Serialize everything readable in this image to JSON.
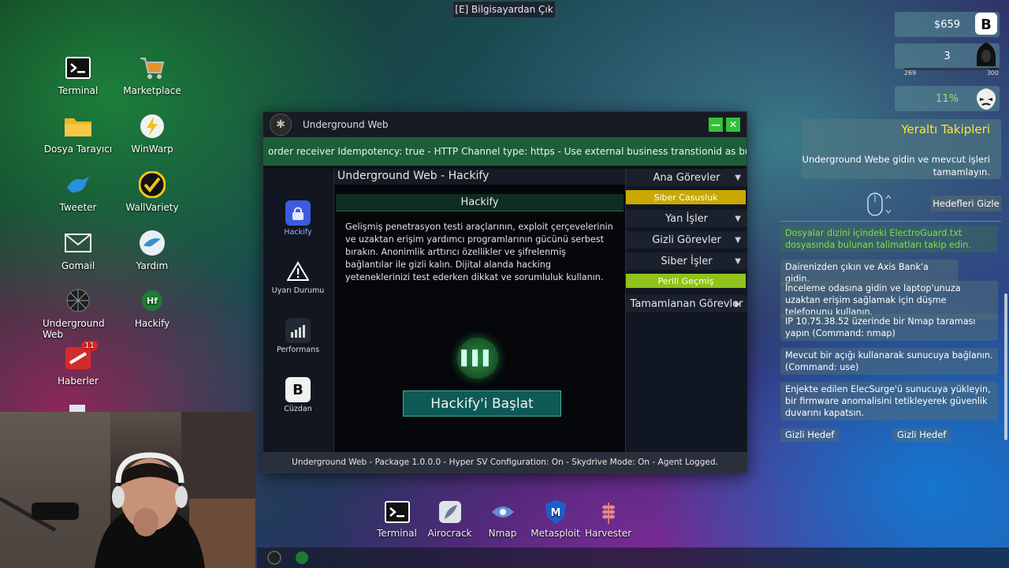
{
  "top_button": "[E] Bilgisayardan Çık",
  "desktop": {
    "icons": [
      {
        "label": "Terminal",
        "icon": "terminal-icon"
      },
      {
        "label": "Marketplace",
        "icon": "cart-icon"
      },
      {
        "label": "Dosya Tarayıcı",
        "icon": "folder-icon"
      },
      {
        "label": "WinWarp",
        "icon": "lightning-icon"
      },
      {
        "label": "Tweeter",
        "icon": "bird-icon"
      },
      {
        "label": "WallVariety",
        "icon": "wallpaper-icon"
      },
      {
        "label": "Gomail",
        "icon": "mail-icon"
      },
      {
        "label": "Yardım",
        "icon": "help-bird-icon"
      },
      {
        "label": "Underground Web",
        "icon": "web-icon"
      },
      {
        "label": "Hackify",
        "icon": "hackify-icon"
      },
      {
        "label": "Haberler",
        "icon": "news-icon",
        "badge": "11"
      }
    ]
  },
  "window": {
    "title": "Underground Web",
    "marquee": "order receiver Idempotency: true - HTTP Channel type: https - Use external business transtionid as business transa",
    "nav": [
      {
        "label": "Hackify",
        "icon": "lock-icon"
      },
      {
        "label": "Uyarı Durumu",
        "icon": "warning-icon"
      },
      {
        "label": "Performans",
        "icon": "chart-icon"
      },
      {
        "label": "Cüzdan",
        "icon": "wallet-icon"
      }
    ],
    "header": "Underground Web - Hackify",
    "section_title": "Hackify",
    "description": "Gelişmiş penetrasyon testi araçlarının, exploit çerçevelerinin ve uzaktan erişim yardımcı programlarının gücünü serbest bırakın. Anonimlik arttırıcı özellikler ve şifrelenmiş bağlantılar ile gizli kalın. Dijital alanda hacking yeteneklerinizi test ederken dikkat ve sorumluluk kullanın.",
    "start_button": "Hackify'i Başlat",
    "menu": {
      "ana": "Ana Görevler",
      "siber_casusluk": "Siber Casusluk",
      "yan": "Yan İşler",
      "gizli": "Gizli Görevler",
      "siber": "Siber İşler",
      "perili": "Perili Geçmiş",
      "tamamlanan": "Tamamlanan Görevler"
    },
    "status": "Underground Web - Package 1.0.0.0 - Hyper SV Configuration: On - Skydrive Mode: On - Agent Logged."
  },
  "taskbar": [
    {
      "label": "Terminal",
      "icon": "terminal-icon"
    },
    {
      "label": "Airocrack",
      "icon": "feather-icon"
    },
    {
      "label": "Nmap",
      "icon": "eye-icon"
    },
    {
      "label": "Metasploit",
      "icon": "shield-m-icon"
    },
    {
      "label": "Harvester",
      "icon": "wheat-icon"
    }
  ],
  "hud": {
    "money": "$659",
    "level": "3",
    "xp_min": "269",
    "xp_max": "300",
    "xp_progress": 0.9,
    "percent": "11%"
  },
  "quest": {
    "title": "Yeraltı Takipleri",
    "desc": "Underground Webe gidin ve mevcut işleri tamamlayın.",
    "hide_button": "Hedefleri Gizle",
    "tasks": [
      "Dosyalar dizini içindeki ElectroGuard.txt dosyasında bulunan talimatları takip edin.",
      "Dairenizden çıkın ve Axis Bank'a gidin.",
      "İnceleme odasına gidin ve laptop'unuza uzaktan erişim sağlamak için düşme telefonunu kullanın.",
      "IP 10.75.38.52 üzerinde bir Nmap taraması yapın (Command: nmap)",
      "Mevcut bir açığı kullanarak sunucuya bağlanın. (Command: use)",
      "Enjekte edilen ElecSurge'ü sunucuya yükleyin, bir firmware anomalisini tetikleyerek güvenlik duvarını kapatsın."
    ],
    "hidden_goal_1": "Gizli Hedef",
    "hidden_goal_2": "Gizli Hedef"
  },
  "colors": {
    "accent_green": "#33c13a",
    "yellow_chip": "#c9a800",
    "lime_chip": "#8fc21a",
    "quest_title": "#ffe33a"
  }
}
